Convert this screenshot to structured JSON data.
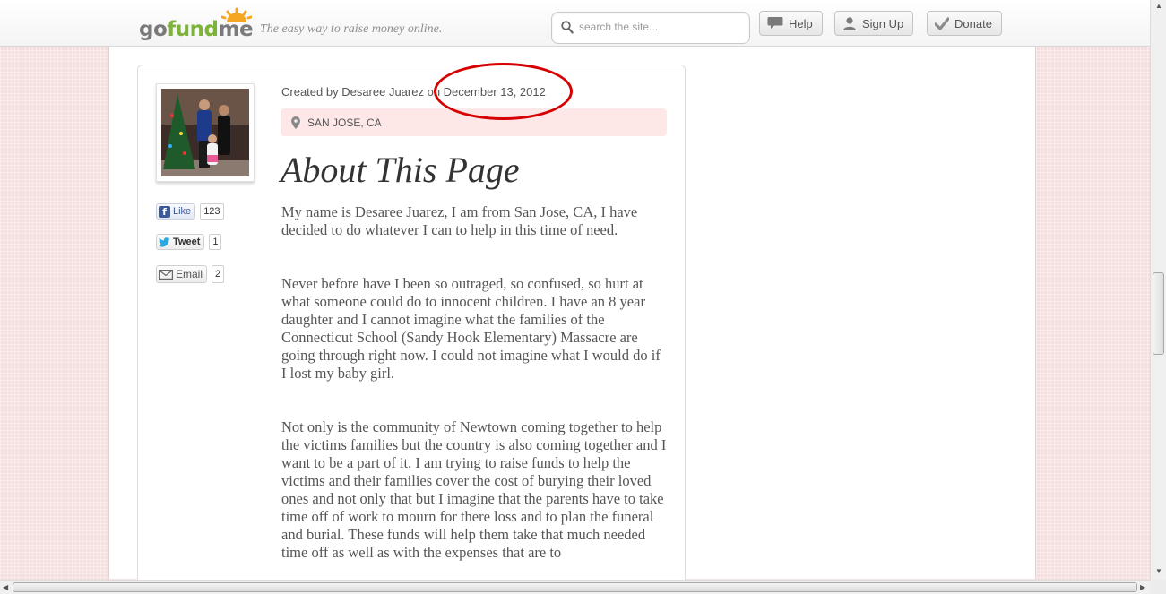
{
  "header": {
    "logo_go": "go",
    "logo_fund": "fund",
    "logo_me": "me",
    "tagline": "The easy way to raise money online.",
    "search_placeholder": "search the site...",
    "help_label": "Help",
    "signup_label": "Sign Up",
    "donate_label": "Donate"
  },
  "social": {
    "like_label": "Like",
    "like_count": "123",
    "tweet_label": "Tweet",
    "tweet_count": "1",
    "email_label": "Email",
    "email_count": "2"
  },
  "campaign": {
    "created_prefix": "Created by Desaree Juarez on ",
    "created_date": "December 13, 2012",
    "location": "SAN JOSE, CA",
    "about_title": "About This Page",
    "paragraphs": [
      "My name is Desaree Juarez, I am from San Jose, CA, I have decided to do whatever I can to help in this time of need.",
      "Never before have I been so outraged, so confused, so hurt at what someone could do to innocent children.  I have an 8 year daughter and I cannot imagine what the families of the Connecticut School (Sandy Hook Elementary) Massacre are going through right now. I could not imagine what I would do if I lost my baby girl.",
      "Not only is the community of Newtown coming together to help the victims families but the country is also coming together and I want to be a part of it. I am trying to raise funds to help the victims and their families cover the cost of burying their loved ones and not only that but I imagine that the parents have to take time off of work to mourn for there loss and to plan the funeral and burial.  These funds will help them take that much needed time off as well as with the expenses that are to"
    ]
  },
  "colors": {
    "accent_green": "#7db33a",
    "annotation_red": "#d60000",
    "location_bg": "#fde7e7"
  }
}
